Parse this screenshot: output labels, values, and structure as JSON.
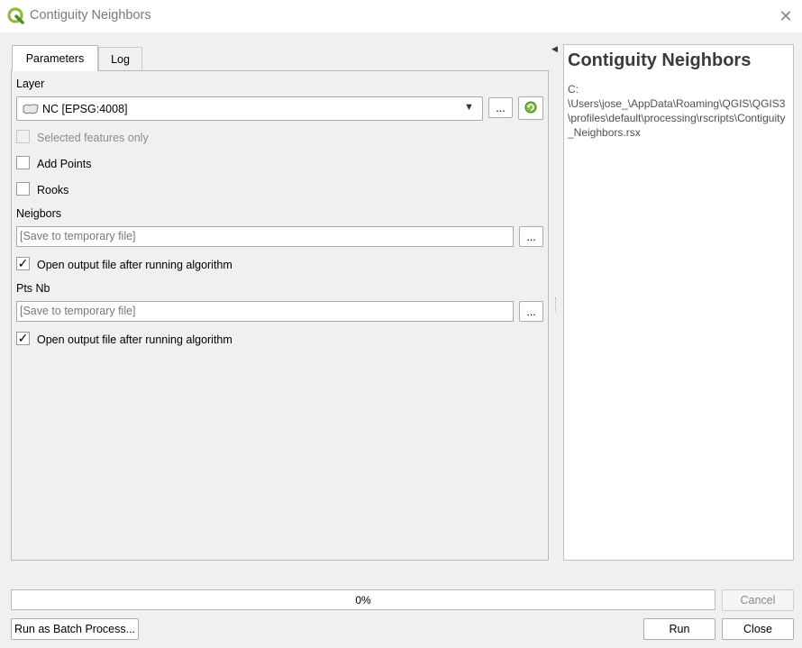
{
  "window": {
    "title": "Contiguity Neighbors",
    "icon": "qgis-logo-icon"
  },
  "tabs": [
    {
      "label": "Parameters"
    },
    {
      "label": "Log"
    }
  ],
  "params": {
    "layer": {
      "label": "Layer",
      "value": "NC [EPSG:4008]",
      "browse_label": "...",
      "icon": "polygon-layer-icon"
    },
    "selected_only": {
      "label": "Selected features only",
      "checked": false,
      "disabled": true
    },
    "add_points": {
      "label": "Add Points",
      "checked": false
    },
    "rooks": {
      "label": "Rooks",
      "checked": false
    },
    "neighbors": {
      "label": "Neigbors",
      "placeholder": "[Save to temporary file]",
      "browse_label": "...",
      "open_label": "Open output file after running algorithm",
      "open_checked": true
    },
    "pts_nb": {
      "label": "Pts Nb",
      "placeholder": "[Save to temporary file]",
      "browse_label": "...",
      "open_label": "Open output file after running algorithm",
      "open_checked": true
    }
  },
  "help": {
    "title": "Contiguity Neighbors",
    "path": "C:\n\\Users\\jose_\\AppData\\Roaming\\QGIS\\QGIS3\\profiles\\default\\processing\\rscripts\\Contiguity_Neighbors.rsx"
  },
  "progress": {
    "text": "0%",
    "percent": 0
  },
  "buttons": {
    "cancel": "Cancel",
    "batch": "Run as Batch Process...",
    "run": "Run",
    "close": "Close"
  },
  "colors": {
    "qgis_green": "#8fbc3a",
    "qgis_dark_green": "#4b8a2a"
  }
}
